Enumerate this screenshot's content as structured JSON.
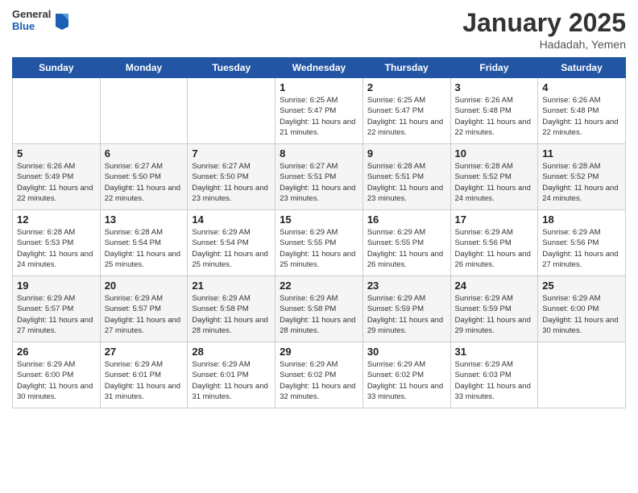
{
  "header": {
    "logo_general": "General",
    "logo_blue": "Blue",
    "title": "January 2025",
    "location": "Hadadah, Yemen"
  },
  "days_of_week": [
    "Sunday",
    "Monday",
    "Tuesday",
    "Wednesday",
    "Thursday",
    "Friday",
    "Saturday"
  ],
  "weeks": [
    [
      {
        "day": "",
        "info": ""
      },
      {
        "day": "",
        "info": ""
      },
      {
        "day": "",
        "info": ""
      },
      {
        "day": "1",
        "info": "Sunrise: 6:25 AM\nSunset: 5:47 PM\nDaylight: 11 hours and 21 minutes."
      },
      {
        "day": "2",
        "info": "Sunrise: 6:25 AM\nSunset: 5:47 PM\nDaylight: 11 hours and 22 minutes."
      },
      {
        "day": "3",
        "info": "Sunrise: 6:26 AM\nSunset: 5:48 PM\nDaylight: 11 hours and 22 minutes."
      },
      {
        "day": "4",
        "info": "Sunrise: 6:26 AM\nSunset: 5:48 PM\nDaylight: 11 hours and 22 minutes."
      }
    ],
    [
      {
        "day": "5",
        "info": "Sunrise: 6:26 AM\nSunset: 5:49 PM\nDaylight: 11 hours and 22 minutes."
      },
      {
        "day": "6",
        "info": "Sunrise: 6:27 AM\nSunset: 5:50 PM\nDaylight: 11 hours and 22 minutes."
      },
      {
        "day": "7",
        "info": "Sunrise: 6:27 AM\nSunset: 5:50 PM\nDaylight: 11 hours and 23 minutes."
      },
      {
        "day": "8",
        "info": "Sunrise: 6:27 AM\nSunset: 5:51 PM\nDaylight: 11 hours and 23 minutes."
      },
      {
        "day": "9",
        "info": "Sunrise: 6:28 AM\nSunset: 5:51 PM\nDaylight: 11 hours and 23 minutes."
      },
      {
        "day": "10",
        "info": "Sunrise: 6:28 AM\nSunset: 5:52 PM\nDaylight: 11 hours and 24 minutes."
      },
      {
        "day": "11",
        "info": "Sunrise: 6:28 AM\nSunset: 5:52 PM\nDaylight: 11 hours and 24 minutes."
      }
    ],
    [
      {
        "day": "12",
        "info": "Sunrise: 6:28 AM\nSunset: 5:53 PM\nDaylight: 11 hours and 24 minutes."
      },
      {
        "day": "13",
        "info": "Sunrise: 6:28 AM\nSunset: 5:54 PM\nDaylight: 11 hours and 25 minutes."
      },
      {
        "day": "14",
        "info": "Sunrise: 6:29 AM\nSunset: 5:54 PM\nDaylight: 11 hours and 25 minutes."
      },
      {
        "day": "15",
        "info": "Sunrise: 6:29 AM\nSunset: 5:55 PM\nDaylight: 11 hours and 25 minutes."
      },
      {
        "day": "16",
        "info": "Sunrise: 6:29 AM\nSunset: 5:55 PM\nDaylight: 11 hours and 26 minutes."
      },
      {
        "day": "17",
        "info": "Sunrise: 6:29 AM\nSunset: 5:56 PM\nDaylight: 11 hours and 26 minutes."
      },
      {
        "day": "18",
        "info": "Sunrise: 6:29 AM\nSunset: 5:56 PM\nDaylight: 11 hours and 27 minutes."
      }
    ],
    [
      {
        "day": "19",
        "info": "Sunrise: 6:29 AM\nSunset: 5:57 PM\nDaylight: 11 hours and 27 minutes."
      },
      {
        "day": "20",
        "info": "Sunrise: 6:29 AM\nSunset: 5:57 PM\nDaylight: 11 hours and 27 minutes."
      },
      {
        "day": "21",
        "info": "Sunrise: 6:29 AM\nSunset: 5:58 PM\nDaylight: 11 hours and 28 minutes."
      },
      {
        "day": "22",
        "info": "Sunrise: 6:29 AM\nSunset: 5:58 PM\nDaylight: 11 hours and 28 minutes."
      },
      {
        "day": "23",
        "info": "Sunrise: 6:29 AM\nSunset: 5:59 PM\nDaylight: 11 hours and 29 minutes."
      },
      {
        "day": "24",
        "info": "Sunrise: 6:29 AM\nSunset: 5:59 PM\nDaylight: 11 hours and 29 minutes."
      },
      {
        "day": "25",
        "info": "Sunrise: 6:29 AM\nSunset: 6:00 PM\nDaylight: 11 hours and 30 minutes."
      }
    ],
    [
      {
        "day": "26",
        "info": "Sunrise: 6:29 AM\nSunset: 6:00 PM\nDaylight: 11 hours and 30 minutes."
      },
      {
        "day": "27",
        "info": "Sunrise: 6:29 AM\nSunset: 6:01 PM\nDaylight: 11 hours and 31 minutes."
      },
      {
        "day": "28",
        "info": "Sunrise: 6:29 AM\nSunset: 6:01 PM\nDaylight: 11 hours and 31 minutes."
      },
      {
        "day": "29",
        "info": "Sunrise: 6:29 AM\nSunset: 6:02 PM\nDaylight: 11 hours and 32 minutes."
      },
      {
        "day": "30",
        "info": "Sunrise: 6:29 AM\nSunset: 6:02 PM\nDaylight: 11 hours and 33 minutes."
      },
      {
        "day": "31",
        "info": "Sunrise: 6:29 AM\nSunset: 6:03 PM\nDaylight: 11 hours and 33 minutes."
      },
      {
        "day": "",
        "info": ""
      }
    ]
  ]
}
